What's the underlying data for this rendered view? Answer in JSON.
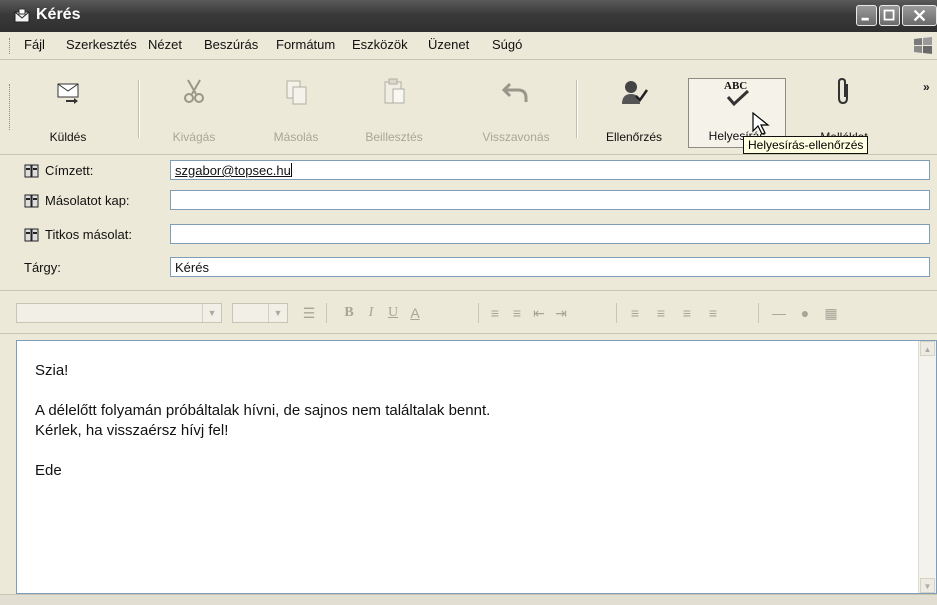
{
  "window": {
    "title": "Kérés"
  },
  "menu": {
    "items": [
      "Fájl",
      "Szerkesztés",
      "Nézet",
      "Beszúrás",
      "Formátum",
      "Eszközök",
      "Üzenet",
      "Súgó"
    ]
  },
  "toolbar": {
    "send": "Küldés",
    "cut": "Kivágás",
    "copy": "Másolás",
    "paste": "Beillesztés",
    "undo": "Visszavonás",
    "check": "Ellenőrzés",
    "spelling": "Helyesírás",
    "attach": "Melléklet",
    "tooltip": "Helyesírás-ellenőrzés",
    "more": "»"
  },
  "fields": {
    "to_label": "Címzett:",
    "to_value": "szgabor@topsec.hu",
    "cc_label": "Másolatot kap:",
    "cc_value": "",
    "bcc_label": "Titkos másolat:",
    "bcc_value": "",
    "subject_label": "Tárgy:",
    "subject_value": "Kérés"
  },
  "body": {
    "lines": [
      "Szia!",
      "",
      "A délelőtt folyamán próbáltalak hívni, de sajnos nem találtalak bennt.",
      "Kérlek, ha visszaérsz hívj fel!",
      "",
      "Ede"
    ]
  },
  "icons": {
    "app": "envelope-icon",
    "send": "send-icon",
    "cut": "scissors-icon",
    "copy": "copy-icon",
    "paste": "paste-icon",
    "undo": "undo-icon",
    "check": "check-names-icon",
    "spelling": "spellcheck-icon",
    "attach": "paperclip-icon",
    "addressbook": "address-book-icon"
  }
}
